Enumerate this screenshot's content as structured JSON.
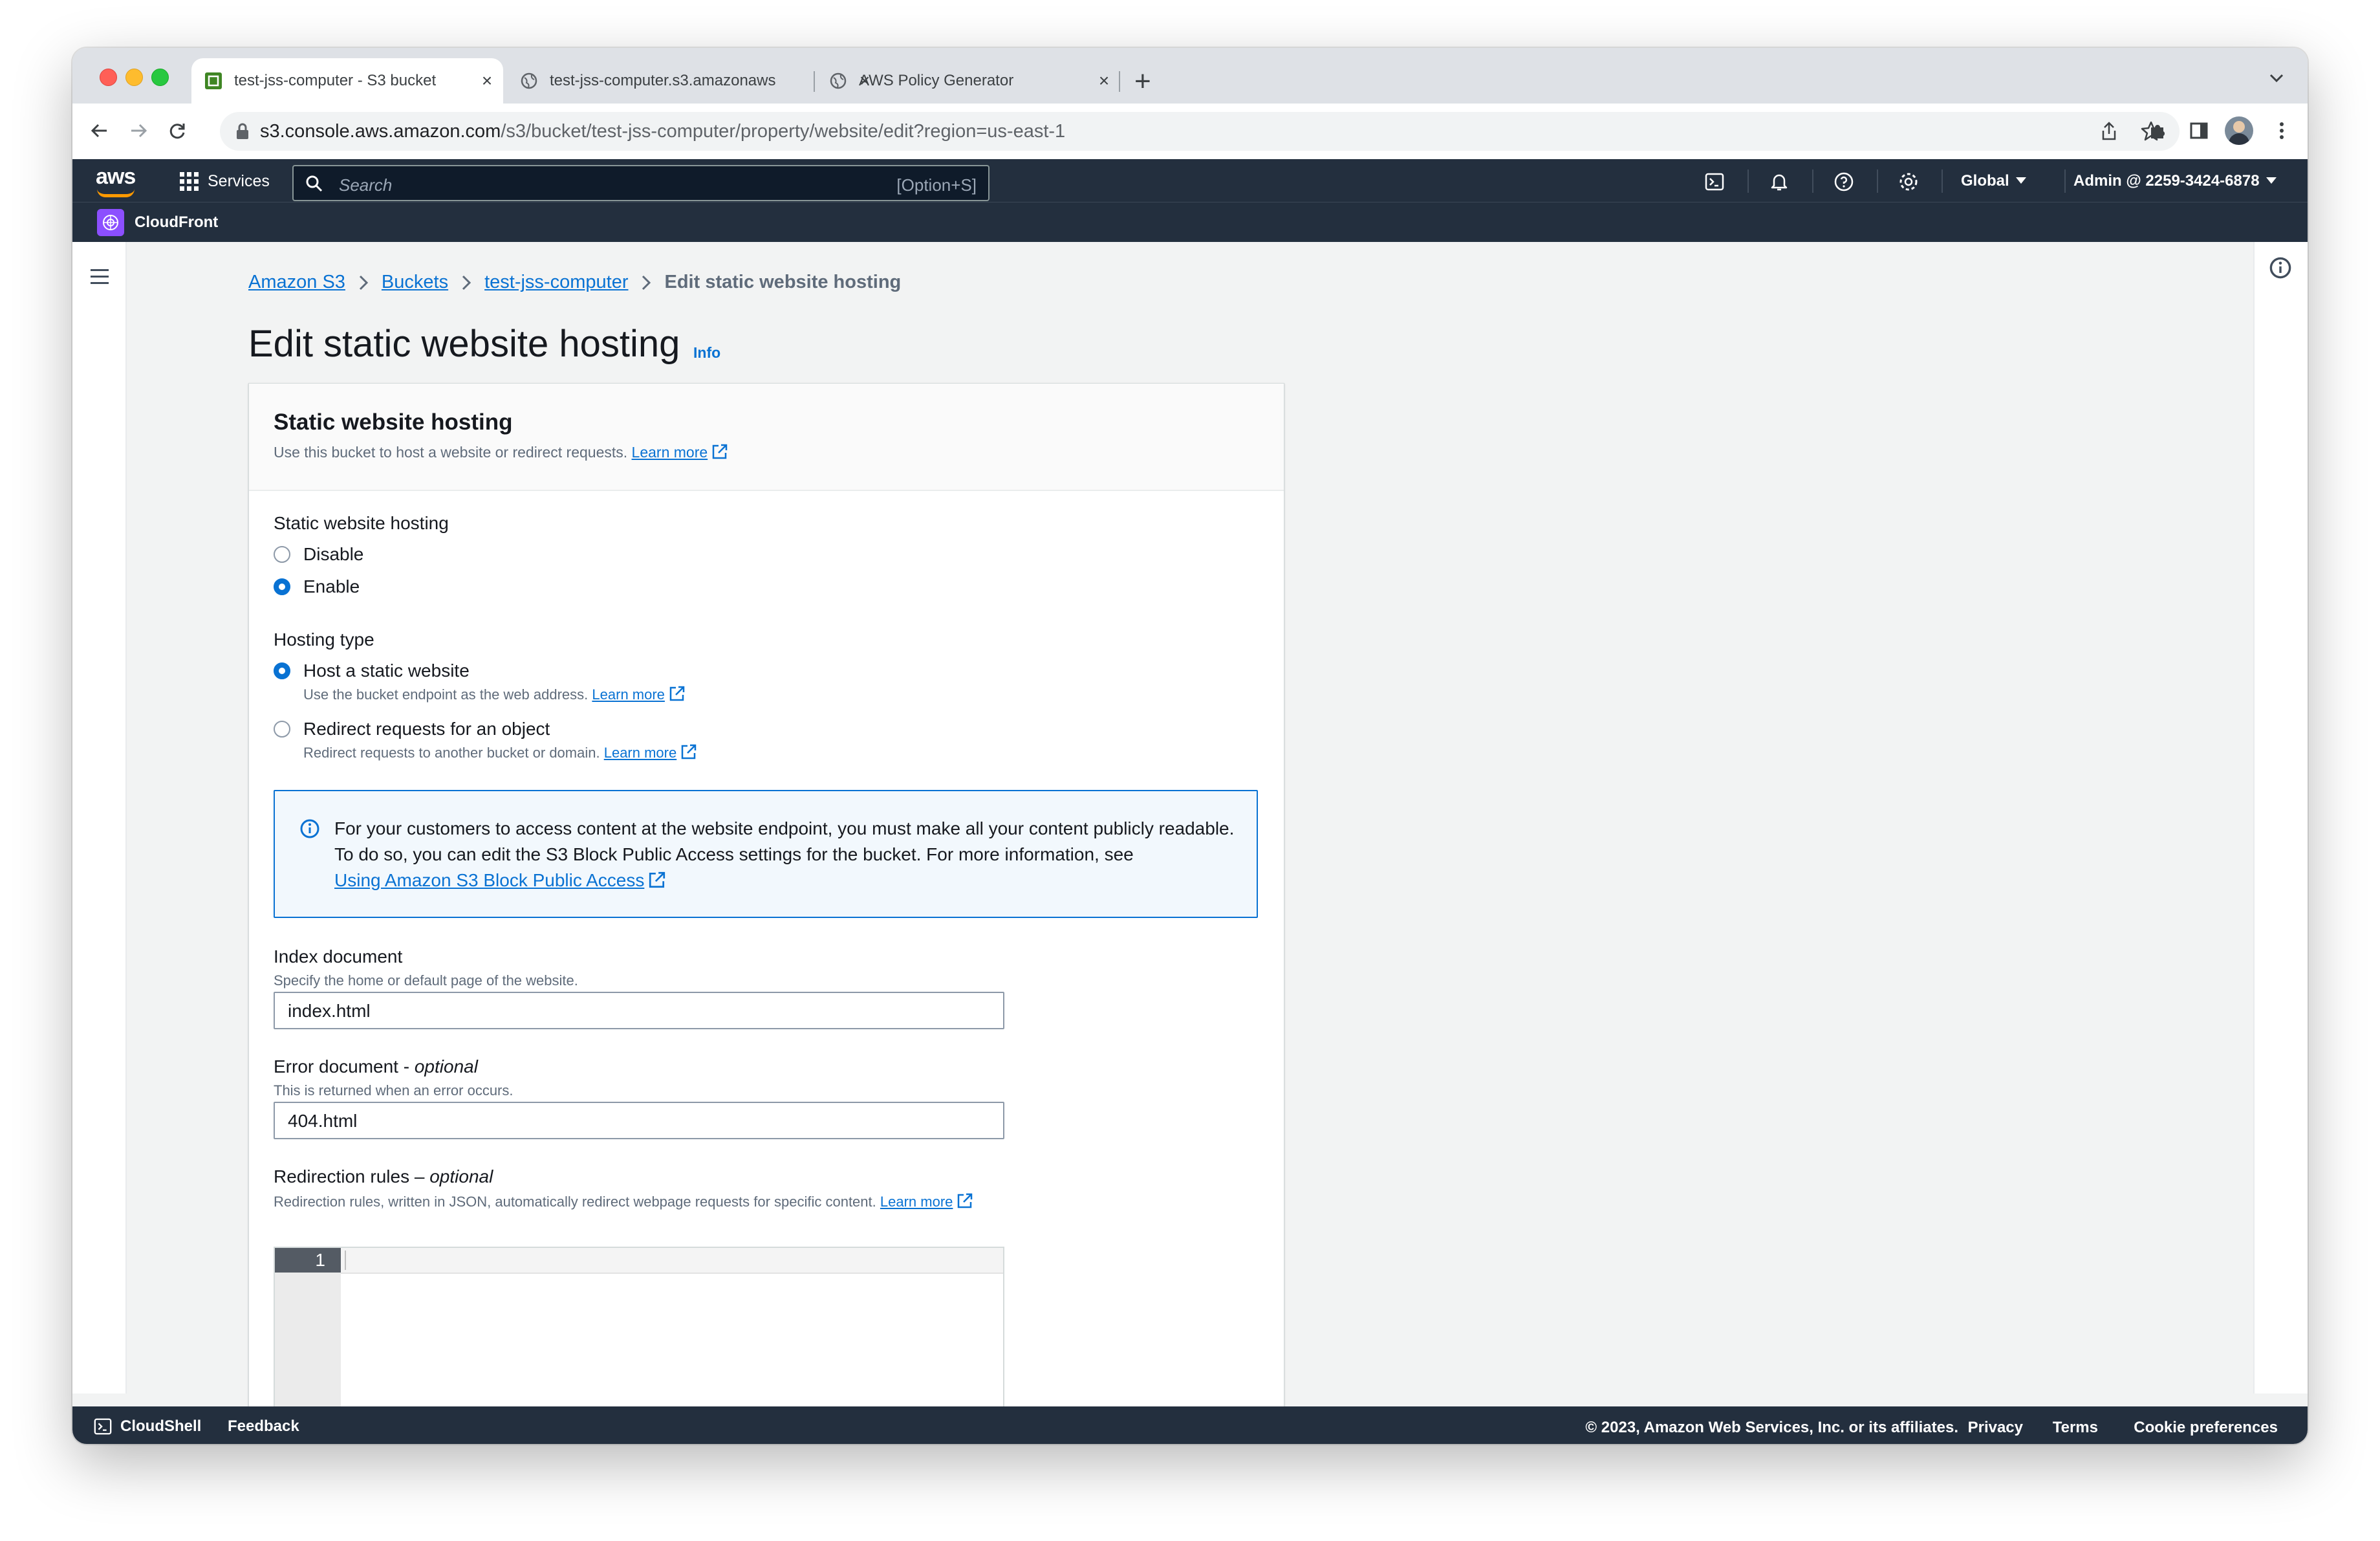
{
  "browser": {
    "tabs": [
      {
        "title": "test-jss-computer - S3 bucket",
        "close": "×"
      },
      {
        "title": "test-jss-computer.s3.amazonaws",
        "close": "×"
      },
      {
        "title": "AWS Policy Generator",
        "close": "×"
      }
    ],
    "new_tab": "+",
    "url_host": "s3.console.aws.amazon.com",
    "url_path": "/s3/bucket/test-jss-computer/property/website/edit?region=us-east-1"
  },
  "aws_header": {
    "logo": "aws",
    "services_label": "Services",
    "search_placeholder": "Search",
    "search_shortcut": "[Option+S]",
    "region": "Global",
    "account": "Admin @ 2259-3424-6878",
    "favorite": "CloudFront"
  },
  "breadcrumbs": [
    "Amazon S3",
    "Buckets",
    "test-jss-computer",
    "Edit static website hosting"
  ],
  "page": {
    "title": "Edit static website hosting",
    "info": "Info"
  },
  "panel": {
    "title": "Static website hosting",
    "description": "Use this bucket to host a website or redirect requests.",
    "learn_more": "Learn more",
    "hosting_label": "Static website hosting",
    "hosting_options": [
      {
        "label": "Disable",
        "selected": false
      },
      {
        "label": "Enable",
        "selected": true
      }
    ],
    "type_label": "Hosting type",
    "type_options": [
      {
        "label": "Host a static website",
        "description": "Use the bucket endpoint as the web address.",
        "selected": true
      },
      {
        "label": "Redirect requests for an object",
        "description": "Redirect requests to another bucket or domain.",
        "selected": false
      }
    ],
    "alert_text": "For your customers to access content at the website endpoint, you must make all your content publicly readable. To do so, you can edit the S3 Block Public Access settings for the bucket. For more information, see",
    "alert_link": "Using Amazon S3 Block Public Access",
    "index_label": "Index document",
    "index_desc": "Specify the home or default page of the website.",
    "index_value": "index.html",
    "error_label": "Error document - ",
    "error_optional": "optional",
    "error_desc": "This is returned when an error occurs.",
    "error_value": "404.html",
    "redirect_label": "Redirection rules – ",
    "redirect_optional": "optional",
    "redirect_desc": "Redirection rules, written in JSON, automatically redirect webpage requests for specific content.",
    "editor_line": "1"
  },
  "footer": {
    "cloudshell": "CloudShell",
    "feedback": "Feedback",
    "copyright": "© 2023, Amazon Web Services, Inc. or its affiliates.",
    "privacy": "Privacy",
    "terms": "Terms",
    "cookies": "Cookie preferences"
  },
  "colors": {
    "aws_header": "#232f3e",
    "link": "#0972d3",
    "aws_orange": "#ff9900",
    "cloudfront": "#8c4fff"
  }
}
